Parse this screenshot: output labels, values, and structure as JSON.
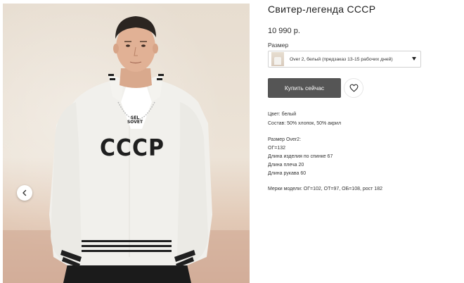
{
  "product": {
    "title": "Свитер-легенда СССР",
    "price": "10 990 р.",
    "size_label": "Размер",
    "size_selected": "Over 2, белый (предзаказ 13-15 рабочих дней)",
    "buy_label": "Купить сейчас"
  },
  "gallery": {
    "sweater_print": "СССР",
    "tshirt_print_line1": "SEL",
    "tshirt_print_line2": "SOVET"
  },
  "specs": {
    "color": "Цвет: белый",
    "composition": "Состав: 50% хлопок, 50% акрил",
    "size_heading": "Размер Over2:",
    "chest": "ОГ=132",
    "back_length": "Длина изделия по спинке 67",
    "shoulder": "Длина плеча 20",
    "sleeve": "Длина рукава 60",
    "model": "Мерки модели: ОГ=102, ОТ=97, ОБ=108, рост 182"
  },
  "colors": {
    "button_bg": "#555555",
    "sweater": "#f1f0ec",
    "accent_dark": "#1f1f1f"
  },
  "icons": {
    "prev": "chevron-left-icon",
    "favorite": "heart-icon",
    "dropdown": "caret-down-icon"
  }
}
